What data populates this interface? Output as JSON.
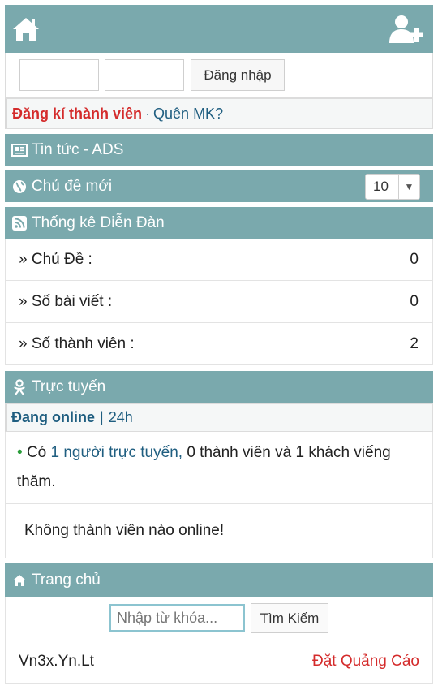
{
  "login": {
    "button_label": "Đăng nhập"
  },
  "register": {
    "register_link": "Đăng kí thành viên",
    "separator": "·",
    "forgot_link": "Quên MK?"
  },
  "sections": {
    "news": "Tin tức - ADS",
    "new_topics": "Chủ đề mới",
    "stats": "Thống kê Diễn Đàn",
    "online": "Trực tuyến",
    "home": "Trang chủ"
  },
  "topics_select": {
    "value": "10"
  },
  "stats": [
    {
      "label": "» Chủ Đề :",
      "value": "0"
    },
    {
      "label": "» Số bài viết :",
      "value": "0"
    },
    {
      "label": "» Số thành viên :",
      "value": "2"
    }
  ],
  "online": {
    "tab_active": "Đang online",
    "tab_separator": "|",
    "tab_other": "24h",
    "bullet": "•",
    "text_prefix": "Có",
    "link_text": "1 người trực tuyến,",
    "text_suffix": "0 thành viên và 1 khách viếng thăm.",
    "no_members": "Không thành viên nào online!"
  },
  "search": {
    "placeholder": "Nhập từ khóa...",
    "button_label": "Tìm Kiếm"
  },
  "footer": {
    "site": "Vn3x.Yn.Lt",
    "ads_link": "Đặt Quảng Cáo"
  },
  "colors": {
    "bar": "#7aa9ad",
    "red_link": "#d42b2b",
    "blue_link": "#1f5e80"
  },
  "icons": {
    "top_left": "home-icon",
    "top_right": "add-user-icon",
    "news": "newspaper-icon",
    "new_topics": "globe-icon",
    "stats": "rss-icon",
    "online": "odnoklassniki-icon",
    "home": "home-icon"
  }
}
